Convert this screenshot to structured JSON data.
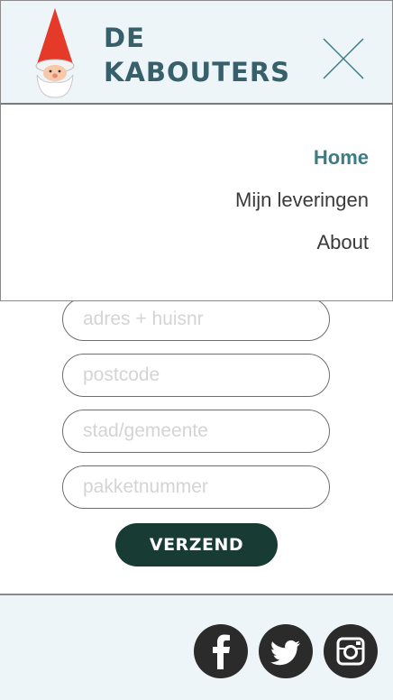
{
  "brand": {
    "line1": "DE",
    "line2": "KABOUTERS",
    "color": "#37606b"
  },
  "nav": {
    "items": [
      {
        "label": "Home",
        "active": true
      },
      {
        "label": "Mijn leveringen",
        "active": false
      },
      {
        "label": "About",
        "active": false
      }
    ]
  },
  "form": {
    "address_placeholder": "adres + huisnr",
    "postcode_placeholder": "postcode",
    "city_placeholder": "stad/gemeente",
    "package_placeholder": "pakketnummer",
    "submit_label": "VERZEND"
  },
  "footer": {
    "social": [
      "facebook-icon",
      "twitter-icon",
      "instagram-icon"
    ]
  },
  "colors": {
    "header_bg": "#eef5f9",
    "accent": "#3b7c86",
    "button": "#183b34"
  }
}
